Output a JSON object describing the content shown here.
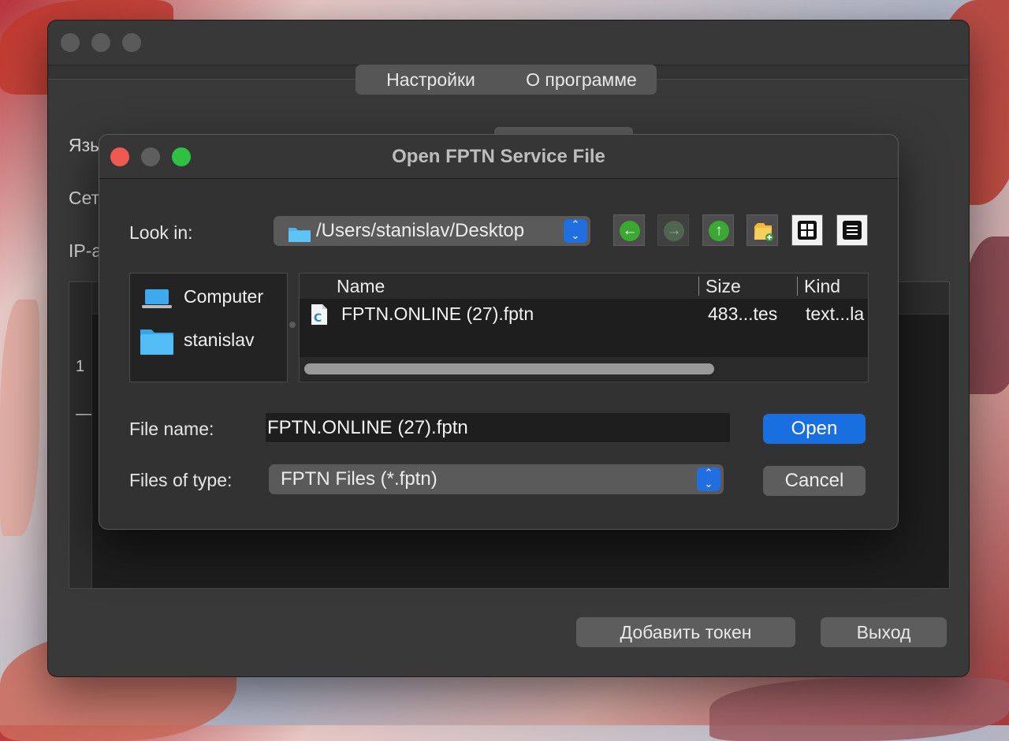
{
  "main_window": {
    "tabs": [
      {
        "label": "Настройки"
      },
      {
        "label": "О программе"
      }
    ],
    "labels": {
      "language": "Язы",
      "network": "Сет",
      "ip": "IP-а"
    },
    "row_numbers": [
      "1",
      "—"
    ],
    "buttons": {
      "add_token": "Добавить токен",
      "exit": "Выход"
    }
  },
  "dialog": {
    "title": "Open FPTN Service File",
    "look_in_label": "Look in:",
    "look_in_path": "/Users/stanislav/Desktop",
    "sidebar": [
      {
        "label": "Computer",
        "icon": "laptop-icon"
      },
      {
        "label": "stanislav",
        "icon": "folder-icon"
      }
    ],
    "columns": [
      "Name",
      "Size",
      "Kind"
    ],
    "files": [
      {
        "name": "FPTN.ONLINE (27).fptn",
        "size": "483...tes",
        "kind": "text...la"
      }
    ],
    "file_name_label": "File name:",
    "file_name_value": "FPTN.ONLINE (27).fptn",
    "file_type_label": "Files of type:",
    "file_type_value": "FPTN Files (*.fptn)",
    "open_button": "Open",
    "cancel_button": "Cancel"
  },
  "colors": {
    "accent": "#1a6fe0",
    "close": "#ee5a52",
    "minimize": "#5e5e5e",
    "zoom": "#2fc144"
  }
}
